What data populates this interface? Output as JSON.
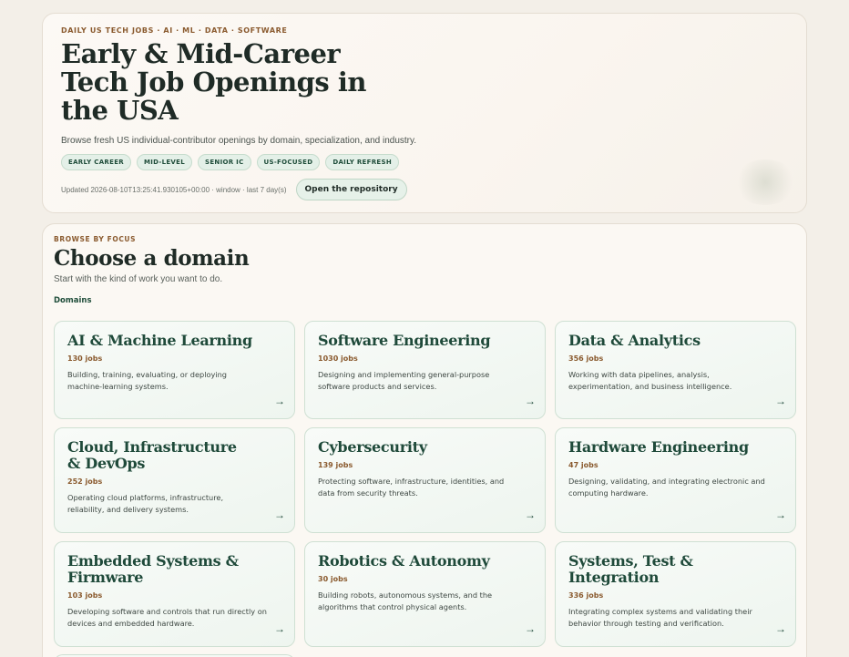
{
  "hero": {
    "eyebrow": "DAILY US TECH JOBS · AI · ML · DATA · SOFTWARE",
    "title": "Early & Mid-Career Tech Job Openings in the USA",
    "subtitle": "Browse fresh US individual-contributor openings by domain, specialization, and industry.",
    "tags": [
      "EARLY CAREER",
      "MID-LEVEL",
      "SENIOR IC",
      "US-FOCUSED",
      "DAILY REFRESH"
    ],
    "updated": "Updated 2026-08-10T13:25:41.930105+00:00 · window · last 7 day(s)",
    "repo_button": "Open the repository"
  },
  "browse": {
    "eyebrow": "BROWSE BY FOCUS",
    "title": "Choose a domain",
    "subtitle": "Start with the kind of work you want to do.",
    "domains_label": "Domains",
    "cards": [
      {
        "title": "AI & Machine Learning",
        "count": "130 jobs",
        "desc": "Building, training, evaluating, or deploying machine-learning systems.",
        "arrow": "→"
      },
      {
        "title": "Software Engineering",
        "count": "1030 jobs",
        "desc": "Designing and implementing general-purpose software products and services.",
        "arrow": "→"
      },
      {
        "title": "Data & Analytics",
        "count": "356 jobs",
        "desc": "Working with data pipelines, analysis, experimentation, and business intelligence.",
        "arrow": "→"
      },
      {
        "title": "Cloud, Infrastructure & DevOps",
        "count": "252 jobs",
        "desc": "Operating cloud platforms, infrastructure, reliability, and delivery systems.",
        "arrow": "→"
      },
      {
        "title": "Cybersecurity",
        "count": "139 jobs",
        "desc": "Protecting software, infrastructure, identities, and data from security threats.",
        "arrow": "→"
      },
      {
        "title": "Hardware Engineering",
        "count": "47 jobs",
        "desc": "Designing, validating, and integrating electronic and computing hardware.",
        "arrow": "→"
      },
      {
        "title": "Embedded Systems & Firmware",
        "count": "103 jobs",
        "desc": "Developing software and controls that run directly on devices and embedded hardware.",
        "arrow": "→"
      },
      {
        "title": "Robotics & Autonomy",
        "count": "30 jobs",
        "desc": "Building robots, autonomous systems, and the algorithms that control physical agents.",
        "arrow": "→"
      },
      {
        "title": "Systems, Test & Integration",
        "count": "336 jobs",
        "desc": "Integrating complex systems and validating their behavior through testing and verification.",
        "arrow": "→"
      }
    ]
  }
}
